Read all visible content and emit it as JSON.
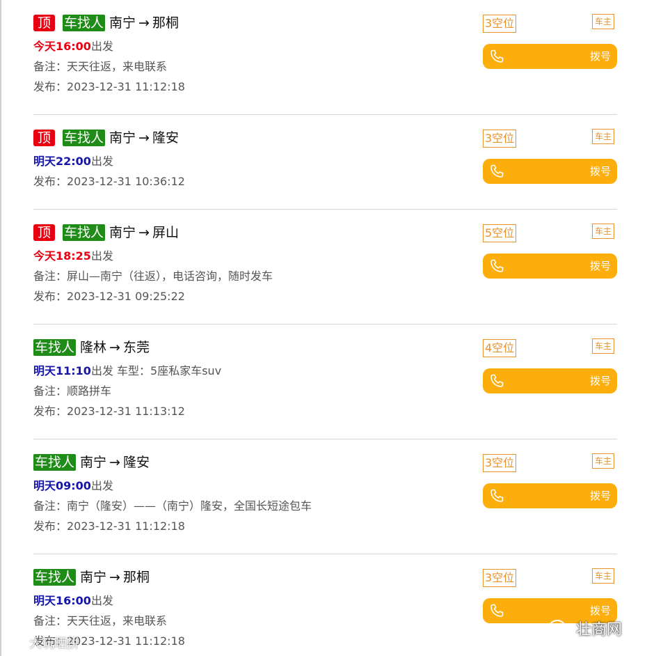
{
  "listings": [
    {
      "pinned_label": "顶",
      "type_label": "车找人",
      "origin": "南宁",
      "arrow": "→",
      "destination": "那桐",
      "depart_time": "今天16:00",
      "depart_suffix": "出发",
      "extra": "",
      "note": "备注：天天往返，来电联系",
      "published": "发布：2023-12-31 11:12:18",
      "seats": "3空位",
      "role": "车主",
      "dial_label": "拨号"
    },
    {
      "pinned_label": "顶",
      "type_label": "车找人",
      "origin": "南宁",
      "arrow": "→",
      "destination": "隆安",
      "depart_time": "明天22:00",
      "depart_suffix": "出发",
      "extra": "",
      "note": "",
      "published": "发布：2023-12-31 10:36:12",
      "seats": "3空位",
      "role": "车主",
      "dial_label": "拨号"
    },
    {
      "pinned_label": "顶",
      "type_label": "车找人",
      "origin": "南宁",
      "arrow": "→",
      "destination": "屏山",
      "depart_time": "今天18:25",
      "depart_suffix": "出发",
      "extra": "",
      "note": "备注：屏山—南宁（往返），电话咨询，随时发车",
      "published": "发布：2023-12-31 09:25:22",
      "seats": "5空位",
      "role": "车主",
      "dial_label": "拨号"
    },
    {
      "pinned_label": "",
      "type_label": "车找人",
      "origin": "隆林",
      "arrow": "→",
      "destination": "东莞",
      "depart_time": "明天11:10",
      "depart_suffix": "出发",
      "extra": " 车型：5座私家车suv",
      "note": "备注：顺路拼车",
      "published": "发布：2023-12-31 11:13:12",
      "seats": "4空位",
      "role": "车主",
      "dial_label": "拨号"
    },
    {
      "pinned_label": "",
      "type_label": "车找人",
      "origin": "南宁",
      "arrow": "→",
      "destination": "隆安",
      "depart_time": "明天09:00",
      "depart_suffix": "出发",
      "extra": "",
      "note": "备注：南宁（隆安）——（南宁）隆安，全国长短途包车",
      "published": "发布：2023-12-31 11:12:18",
      "seats": "3空位",
      "role": "车主",
      "dial_label": "拨号"
    },
    {
      "pinned_label": "",
      "type_label": "车找人",
      "origin": "南宁",
      "arrow": "→",
      "destination": "那桐",
      "depart_time": "明天16:00",
      "depart_suffix": "出发",
      "extra": "",
      "note": "备注：天天往返，来电联系",
      "published": "发布：2023-12-31 11:12:18",
      "seats": "3空位",
      "role": "车主",
      "dial_label": "拨号"
    }
  ],
  "watermarks": {
    "right_text": "壮商网",
    "right_icon": "wechat-icon",
    "left_text": "大玩晒拼",
    "left_icon": "weibo-icon"
  }
}
